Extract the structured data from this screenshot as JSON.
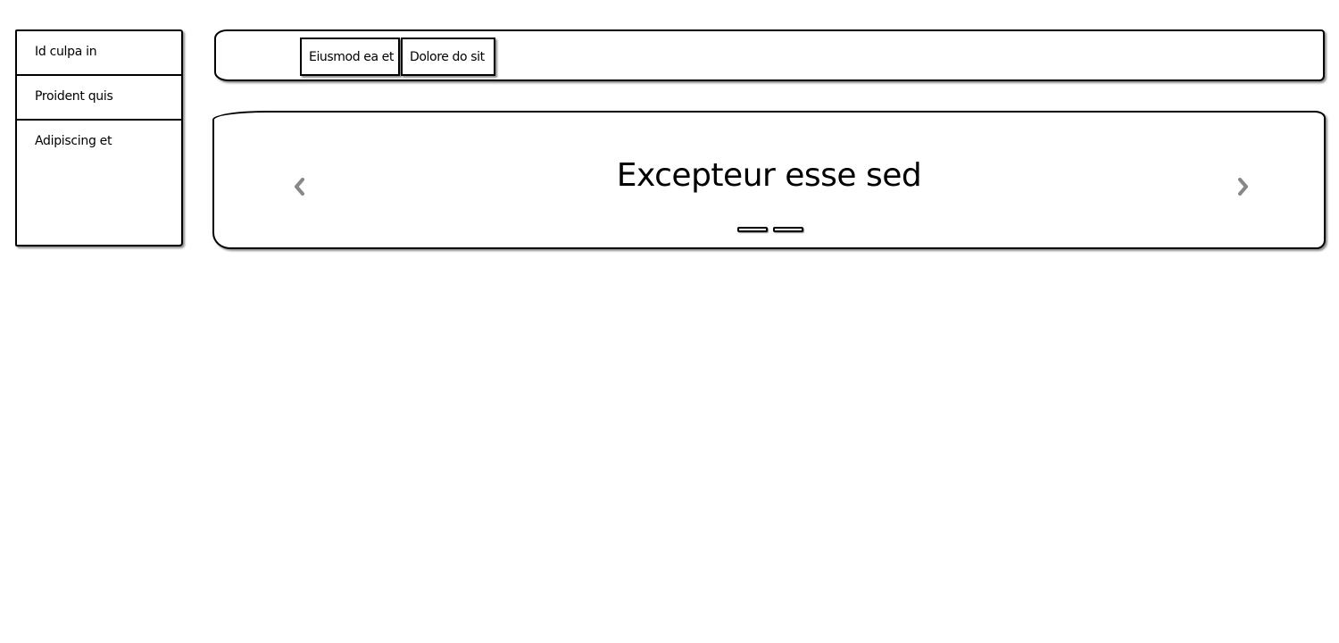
{
  "sidebar": {
    "items": [
      {
        "label": "Id culpa in"
      },
      {
        "label": "Proident quis"
      },
      {
        "label": "Adipiscing et"
      }
    ]
  },
  "tabs": [
    {
      "label": "Eiusmod ea et"
    },
    {
      "label": "Dolore do sit"
    }
  ],
  "carousel": {
    "title": "Excepteur esse sed",
    "prev_icon": "chevron-left-icon",
    "next_icon": "chevron-right-icon",
    "slide_count": 2,
    "arrow_color": "#888888"
  }
}
